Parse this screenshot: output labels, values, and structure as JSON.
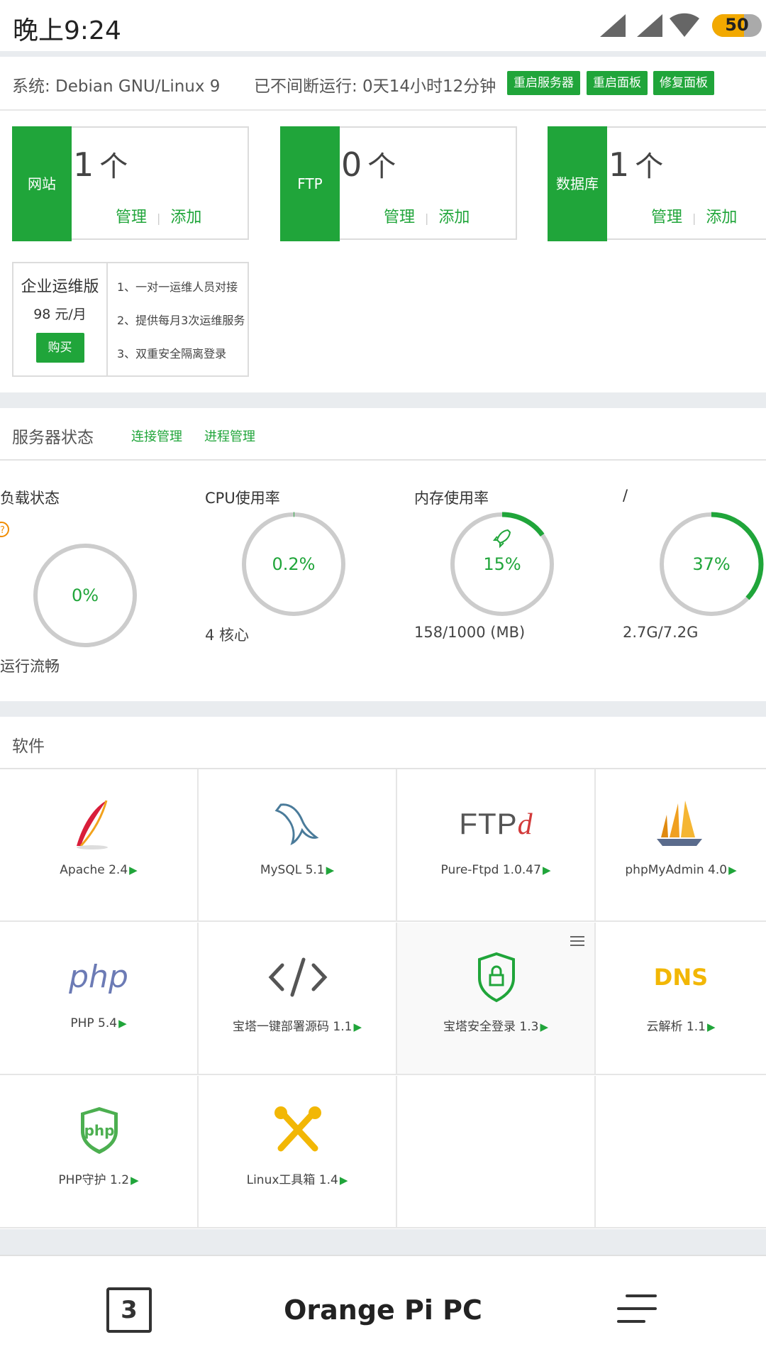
{
  "status_bar": {
    "time": "晚上9:24",
    "battery": "50"
  },
  "system": {
    "os": "系统: Debian GNU/Linux 9",
    "uptime": "已不间断运行: 0天14小时12分钟",
    "buttons": [
      "重启服务器",
      "重启面板",
      "修复面板"
    ]
  },
  "cards": [
    {
      "tag": "网站",
      "count": "1",
      "unit": "个",
      "manage": "管理",
      "add": "添加"
    },
    {
      "tag": "FTP",
      "count": "0",
      "unit": "个",
      "manage": "管理",
      "add": "添加"
    },
    {
      "tag": "数据库",
      "count": "1",
      "unit": "个",
      "manage": "管理",
      "add": "添加"
    }
  ],
  "enterprise": {
    "title": "企业运维版",
    "price": "98 元/月",
    "buy": "购买",
    "features": [
      "1、一对一运维人员对接",
      "2、提供每月3次运维服务",
      "3、双重安全隔离登录"
    ]
  },
  "server_status": {
    "title": "服务器状态",
    "links": [
      "连接管理",
      "进程管理"
    ],
    "load": {
      "label": "负载状态",
      "value": "0%",
      "percent": 0,
      "note": "运行流畅"
    },
    "cpu": {
      "label": "CPU使用率",
      "value": "0.2%",
      "percent": 0.2,
      "note": "4 核心"
    },
    "memory": {
      "label": "内存使用率",
      "value": "15%",
      "percent": 15,
      "note": "158/1000 (MB)"
    },
    "disk": {
      "label": "/",
      "value": "37%",
      "percent": 37,
      "note": "2.7G/7.2G"
    }
  },
  "software": {
    "title": "软件",
    "items": [
      {
        "name": "Apache 2.4",
        "icon": "apache-feather-icon"
      },
      {
        "name": "MySQL 5.1",
        "icon": "mysql-dolphin-icon"
      },
      {
        "name": "Pure-Ftpd 1.0.47",
        "icon": "ftpd-icon"
      },
      {
        "name": "phpMyAdmin 4.0",
        "icon": "phpmyadmin-sailboat-icon"
      },
      {
        "name": "PHP 5.4",
        "icon": "php-icon"
      },
      {
        "name": "宝塔一键部署源码 1.1",
        "icon": "code-icon"
      },
      {
        "name": "宝塔安全登录 1.3",
        "icon": "shield-lock-icon"
      },
      {
        "name": "云解析 1.1",
        "icon": "dns-icon"
      },
      {
        "name": "PHP守护 1.2",
        "icon": "php-shield-icon"
      },
      {
        "name": "Linux工具箱 1.4",
        "icon": "tools-icon"
      }
    ],
    "ftpd_logo": "FTP",
    "ftpd_logo_d": "d",
    "php_logo": "php",
    "dns_logo": "DNS",
    "php_shield_logo": "php"
  },
  "nav": {
    "tabs_count": "3",
    "title": "Orange Pi PC"
  },
  "colors": {
    "accent": "#20a53a",
    "separator": "#e9ecef",
    "battery": "#f2a900"
  }
}
